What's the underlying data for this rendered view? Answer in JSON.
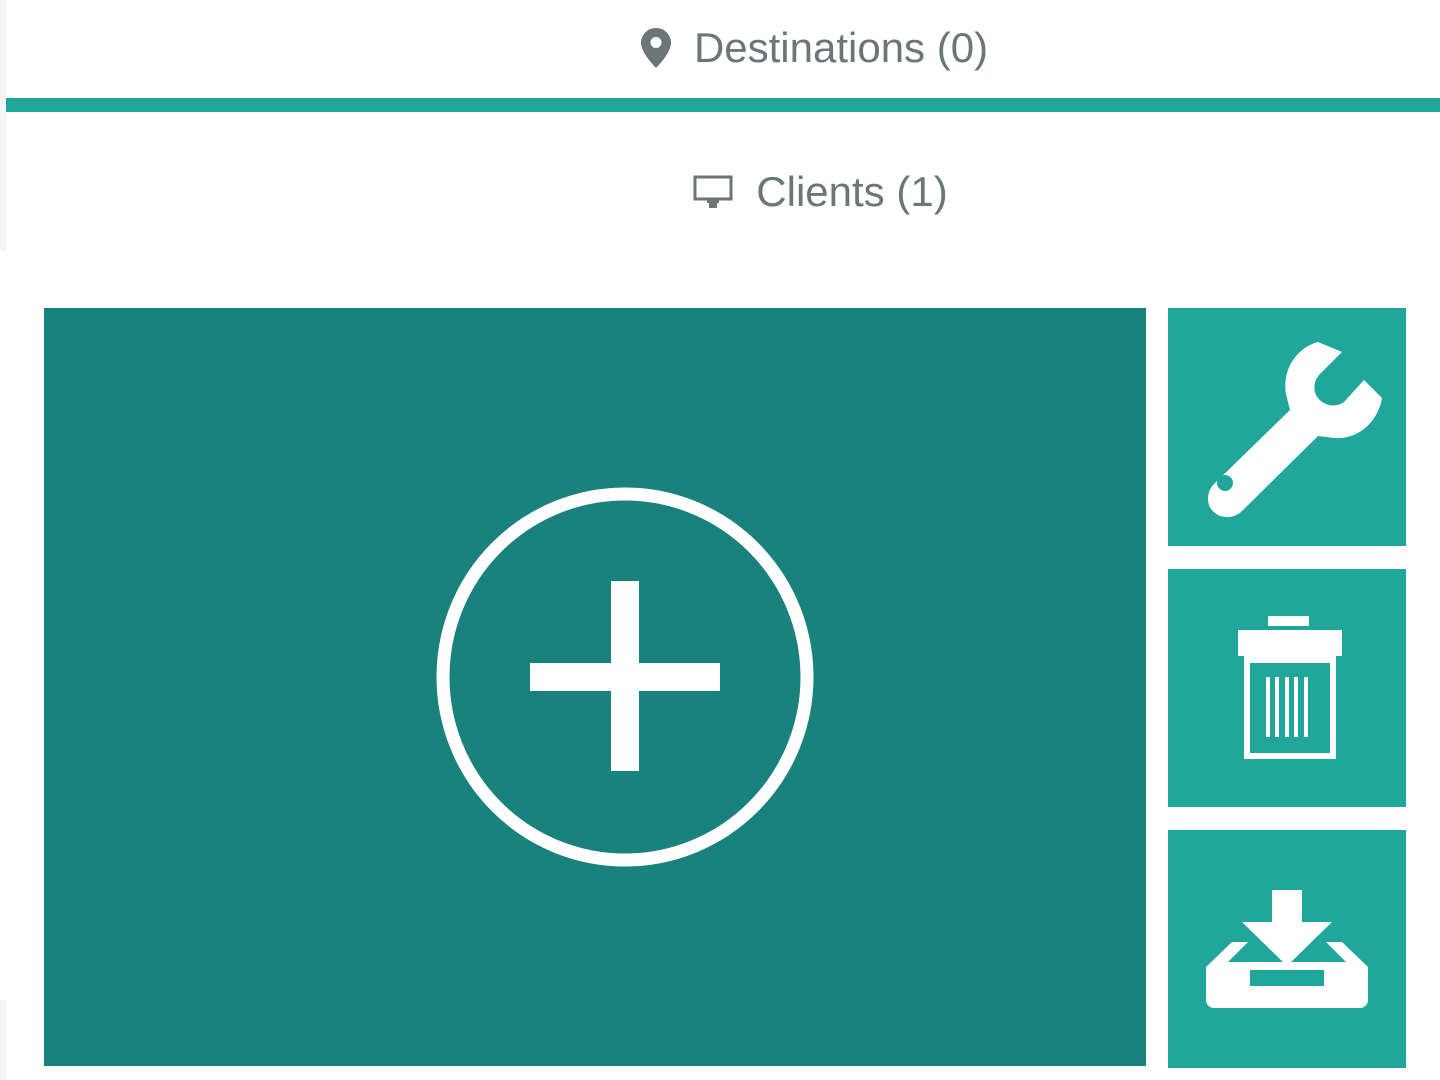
{
  "tabs": {
    "destinations": {
      "label": "Destinations (0)",
      "icon": "map-marker-icon",
      "active": true
    },
    "clients": {
      "label": "Clients (1)",
      "icon": "monitor-icon",
      "active": false
    }
  },
  "tiles": {
    "add": {
      "icon": "plus-circle-icon"
    },
    "settings": {
      "icon": "wrench-icon"
    },
    "delete": {
      "icon": "trash-icon"
    },
    "download": {
      "icon": "download-tray-icon"
    }
  },
  "colors": {
    "accent": "#21a69c",
    "tile_dark": "#19827c",
    "tab_text": "#6b7677"
  }
}
